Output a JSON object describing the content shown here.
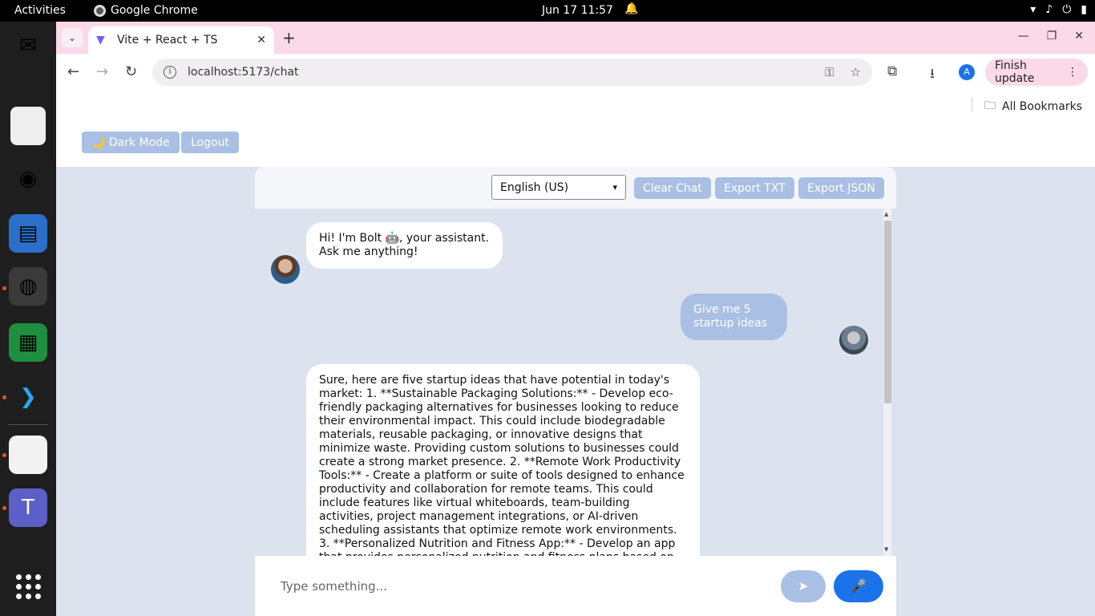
{
  "system": {
    "activities": "Activities",
    "app_name": "Google Chrome",
    "clock": "Jun 17  11:57"
  },
  "browser": {
    "tab_title": "Vite + React + TS",
    "url": "localhost:5173/chat",
    "finish_update": "Finish update",
    "all_bookmarks": "All Bookmarks",
    "profile_initial": "A"
  },
  "app": {
    "dark_mode_label": "🌙 Dark Mode",
    "logout_label": "Logout",
    "language": "English (US)",
    "clear_chat_label": "Clear Chat",
    "export_txt_label": "Export TXT",
    "export_json_label": "Export JSON",
    "input_placeholder": "Type something...",
    "send_icon": "➤",
    "mic_icon": "🎤"
  },
  "messages": [
    {
      "role": "bot",
      "text": "Hi! I'm Bolt 🤖, your assistant. Ask me anything!"
    },
    {
      "role": "user",
      "text": "Give me 5 startup ideas"
    },
    {
      "role": "bot",
      "text": "Sure, here are five startup ideas that have potential in today's market: 1. **Sustainable Packaging Solutions:** - Develop eco-friendly packaging alternatives for businesses looking to reduce their environmental impact. This could include biodegradable materials, reusable packaging, or innovative designs that minimize waste. Providing custom solutions to businesses could create a strong market presence. 2. **Remote Work Productivity Tools:** - Create a platform or suite of tools designed to enhance productivity and collaboration for remote teams. This could include features like virtual whiteboards, team-building activities, project management integrations, or AI-driven scheduling assistants that optimize remote work environments. 3. **Personalized Nutrition and Fitness App:** - Develop an app that provides personalized nutrition and fitness plans based on individual health data, preferences, and goals. By"
    }
  ],
  "colors": {
    "accent": "#a9bfe3",
    "mic": "#1a73e8",
    "background": "#dce3ee"
  }
}
